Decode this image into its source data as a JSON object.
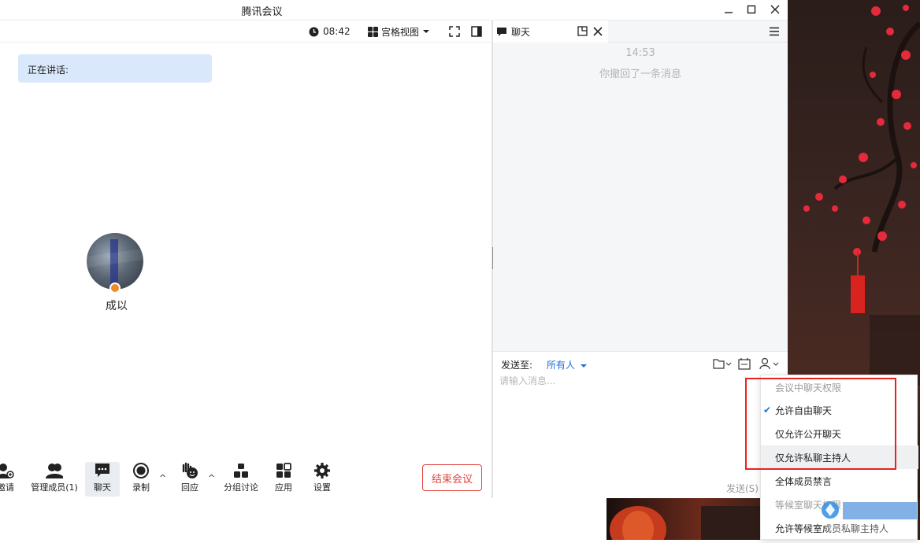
{
  "window": {
    "title": "腾讯会议"
  },
  "meeting_toolbar": {
    "timer": "08:42",
    "view_mode": "宫格视图"
  },
  "meeting": {
    "speaking_label": "正在讲话:",
    "participant_name": "成以"
  },
  "controls": {
    "invite": "邀请",
    "manage_members": "管理成员(1)",
    "chat": "聊天",
    "record": "录制",
    "reactions": "回应",
    "breakout": "分组讨论",
    "apps": "应用",
    "settings": "设置",
    "end_meeting": "结束会议"
  },
  "chat": {
    "tab_label": "聊天",
    "log": {
      "time": "14:53",
      "system_message": "你撤回了一条消息"
    },
    "compose": {
      "send_to_label": "发送至:",
      "send_target": "所有人",
      "input_placeholder": "请输入消息...",
      "send_label": "发送(S)"
    }
  },
  "permission_menu": {
    "items": [
      {
        "label": "会议中聊天权限",
        "type": "header"
      },
      {
        "label": "允许自由聊天",
        "checked": true
      },
      {
        "label": "仅允许公开聊天"
      },
      {
        "label": "仅允许私聊主持人",
        "highlighted": true
      },
      {
        "label": "全体成员禁言"
      },
      {
        "label": "等候室聊天权限",
        "type": "header"
      },
      {
        "label": "允许等候室成员私聊主持人"
      }
    ]
  },
  "colors": {
    "accent": "#1f6fe0",
    "danger": "#e0443d",
    "speaking_bg": "#dae8fb",
    "annotation_box": "#e8231f"
  },
  "icons": {
    "chat_tab": "chat-bubble-icon",
    "popout": "popout-icon",
    "close": "close-icon",
    "menu": "hamburger-icon"
  }
}
